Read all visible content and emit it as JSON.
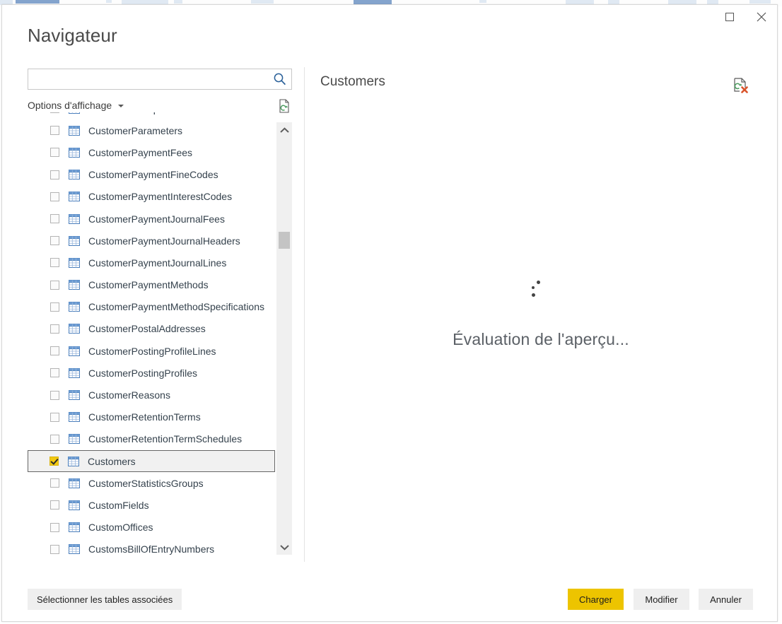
{
  "window": {
    "title": "Navigateur",
    "controls": [
      {
        "name": "maximize-button",
        "icon": "maximize-icon"
      },
      {
        "name": "close-button",
        "icon": "close-icon"
      }
    ]
  },
  "search": {
    "value": "",
    "placeholder": "",
    "icon": "search-icon"
  },
  "view_options": {
    "label": "Options d'affichage",
    "caret_icon": "chevron-down-icon",
    "refresh_icon": "refresh-document-icon"
  },
  "tree": {
    "items": [
      {
        "label": "CustomerGroups",
        "checked": false,
        "selected": false,
        "icon": "table-icon"
      },
      {
        "label": "CustomerParameters",
        "checked": false,
        "selected": false,
        "icon": "table-icon"
      },
      {
        "label": "CustomerPaymentFees",
        "checked": false,
        "selected": false,
        "icon": "table-icon"
      },
      {
        "label": "CustomerPaymentFineCodes",
        "checked": false,
        "selected": false,
        "icon": "table-icon"
      },
      {
        "label": "CustomerPaymentInterestCodes",
        "checked": false,
        "selected": false,
        "icon": "table-icon"
      },
      {
        "label": "CustomerPaymentJournalFees",
        "checked": false,
        "selected": false,
        "icon": "table-icon"
      },
      {
        "label": "CustomerPaymentJournalHeaders",
        "checked": false,
        "selected": false,
        "icon": "table-icon"
      },
      {
        "label": "CustomerPaymentJournalLines",
        "checked": false,
        "selected": false,
        "icon": "table-icon"
      },
      {
        "label": "CustomerPaymentMethods",
        "checked": false,
        "selected": false,
        "icon": "table-icon"
      },
      {
        "label": "CustomerPaymentMethodSpecifications",
        "checked": false,
        "selected": false,
        "icon": "table-icon"
      },
      {
        "label": "CustomerPostalAddresses",
        "checked": false,
        "selected": false,
        "icon": "table-icon"
      },
      {
        "label": "CustomerPostingProfileLines",
        "checked": false,
        "selected": false,
        "icon": "table-icon"
      },
      {
        "label": "CustomerPostingProfiles",
        "checked": false,
        "selected": false,
        "icon": "table-icon"
      },
      {
        "label": "CustomerReasons",
        "checked": false,
        "selected": false,
        "icon": "table-icon"
      },
      {
        "label": "CustomerRetentionTerms",
        "checked": false,
        "selected": false,
        "icon": "table-icon"
      },
      {
        "label": "CustomerRetentionTermSchedules",
        "checked": false,
        "selected": false,
        "icon": "table-icon"
      },
      {
        "label": "Customers",
        "checked": true,
        "selected": true,
        "icon": "table-icon"
      },
      {
        "label": "CustomerStatisticsGroups",
        "checked": false,
        "selected": false,
        "icon": "table-icon"
      },
      {
        "label": "CustomFields",
        "checked": false,
        "selected": false,
        "icon": "table-icon"
      },
      {
        "label": "CustomOffices",
        "checked": false,
        "selected": false,
        "icon": "table-icon"
      },
      {
        "label": "CustomsBillOfEntryNumbers",
        "checked": false,
        "selected": false,
        "icon": "table-icon"
      }
    ],
    "scrollbar": {
      "up_icon": "chevron-up-icon",
      "down_icon": "chevron-down-icon"
    }
  },
  "preview": {
    "title": "Customers",
    "status_text": "Évaluation de l'aperçu...",
    "cancel_icon": "cancel-refresh-icon",
    "spinner": "loading-dots"
  },
  "footer": {
    "related_tables_label": "Sélectionner les tables associées",
    "load_label": "Charger",
    "edit_label": "Modifier",
    "cancel_label": "Annuler"
  },
  "colors": {
    "accent_gold": "#edc400",
    "checkbox_gold": "#f2c811",
    "item_text": "#35424d",
    "title_text": "#4a4a4a",
    "search_icon_blue": "#2a6099",
    "table_icon_blue": "#4a7ebb",
    "cancel_red": "#d9542b",
    "refresh_green": "#4f9e63"
  }
}
